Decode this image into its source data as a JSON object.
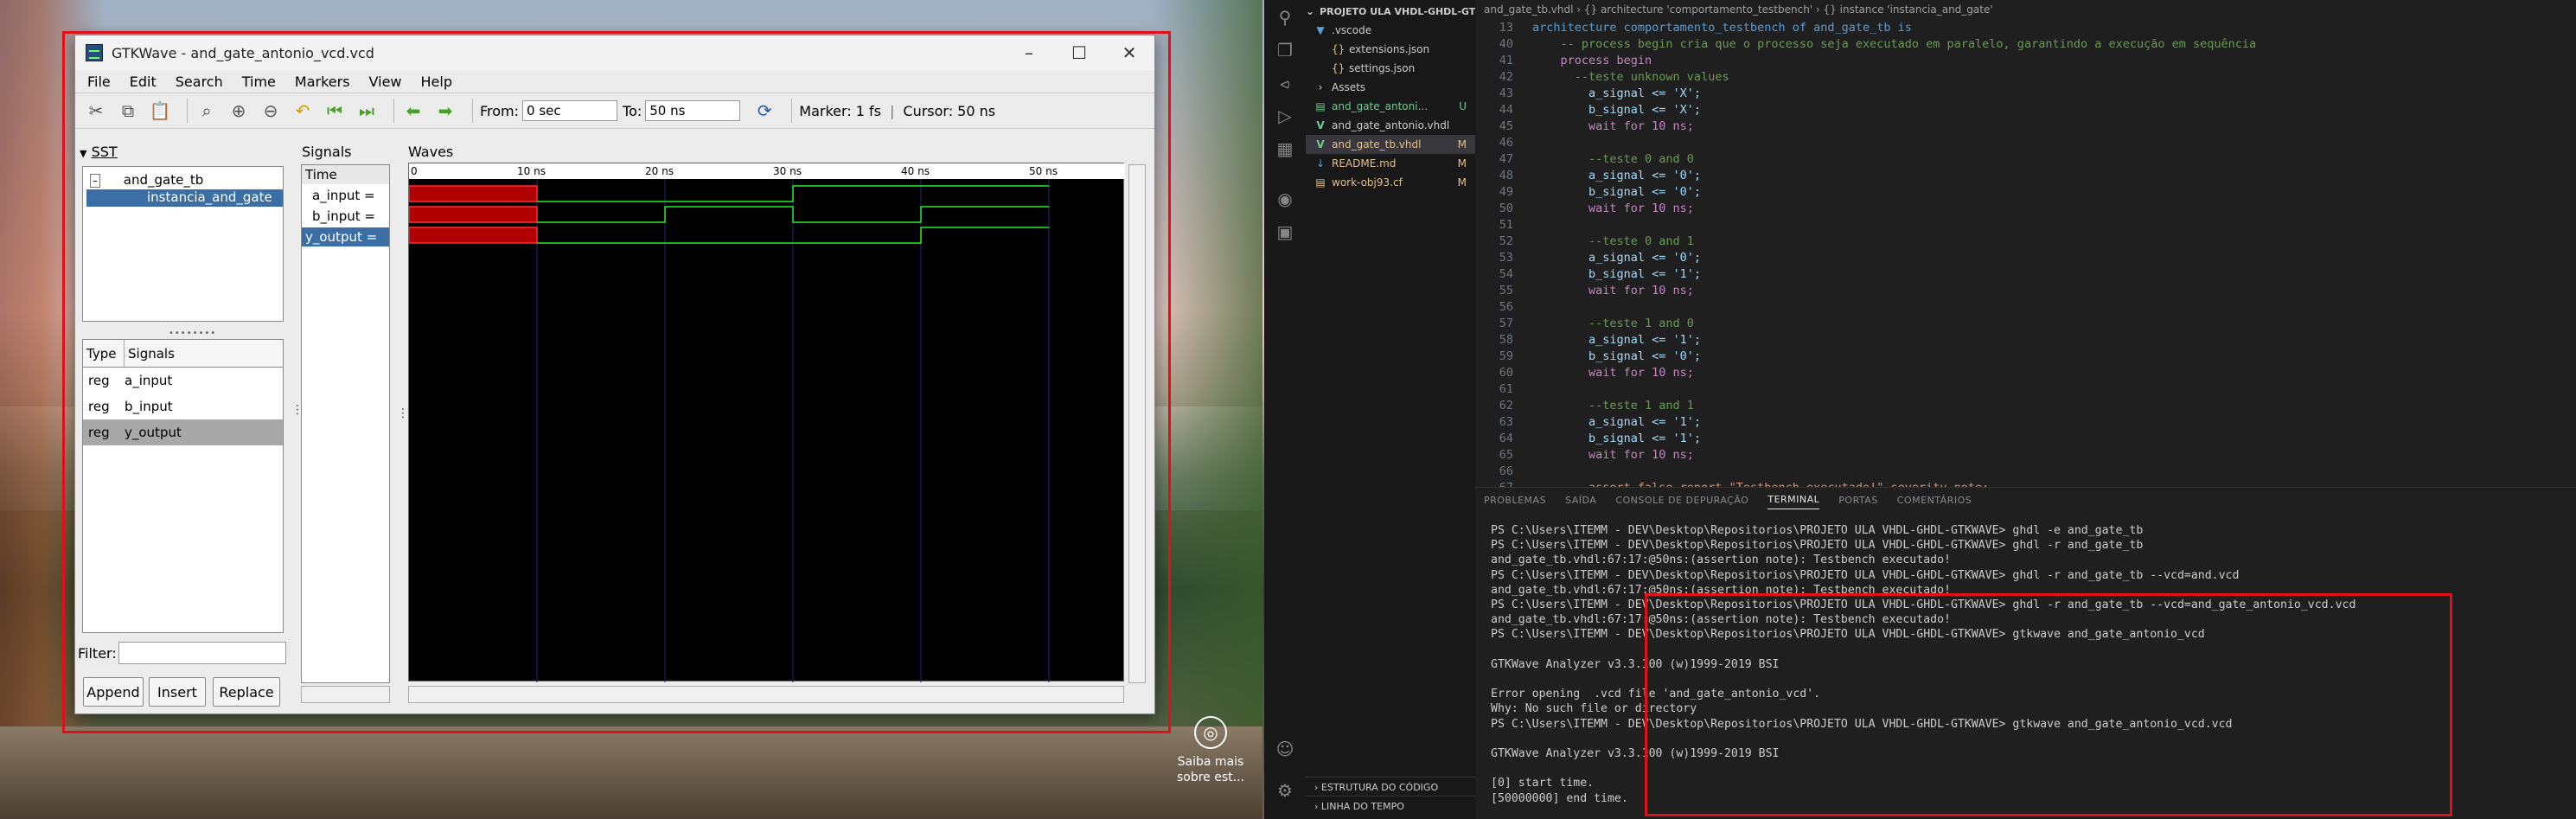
{
  "desktop": {
    "widget_label_1": "Saiba mais",
    "widget_label_2": "sobre est..."
  },
  "gtkwave": {
    "title": "GTKWave - and_gate_antonio_vcd.vcd",
    "menu": [
      "File",
      "Edit",
      "Search",
      "Time",
      "Markers",
      "View",
      "Help"
    ],
    "toolbar": {
      "from_label": "From:",
      "from_value": "0 sec",
      "to_label": "To:",
      "to_value": "50 ns",
      "marker": "Marker: 1 fs",
      "cursor": "Cursor: 50 ns",
      "icons": [
        "cut-icon",
        "copy-icon",
        "paste-icon",
        "zoom-fit-icon",
        "zoom-in-icon",
        "zoom-out-icon",
        "undo-icon",
        "zoom-start-icon",
        "zoom-end-icon",
        "prev-edge-icon",
        "next-edge-icon",
        "reload-icon"
      ]
    },
    "sst": {
      "title": "SST",
      "tree": [
        "and_gate_tb",
        "instancia_and_gate"
      ]
    },
    "signal_table": {
      "col_type": "Type",
      "col_signals": "Signals",
      "rows": [
        {
          "type": "reg",
          "name": "a_input",
          "selected": false
        },
        {
          "type": "reg",
          "name": "b_input",
          "selected": false
        },
        {
          "type": "reg",
          "name": "y_output",
          "selected": true
        }
      ]
    },
    "filter_label": "Filter:",
    "buttons": {
      "append": "Append",
      "insert": "Insert",
      "replace": "Replace"
    },
    "signals_pane": {
      "title": "Signals",
      "time_header": "Time",
      "rows": [
        "a_input =",
        "b_input =",
        "y_output ="
      ]
    },
    "waves_pane": {
      "title": "Waves",
      "tick_labels": [
        "0",
        "10 ns",
        "20 ns",
        "30 ns",
        "40 ns",
        "50 ns"
      ]
    }
  },
  "vscode": {
    "explorer": {
      "root": "PROJETO ULA VHDL-GHDL-GTK...",
      "items": [
        {
          "label": ".vscode",
          "badge": "",
          "color": "#cccccc"
        },
        {
          "label": "extensions.json",
          "badge": "",
          "color": "#cccccc"
        },
        {
          "label": "settings.json",
          "badge": "",
          "color": "#cccccc"
        },
        {
          "label": "Assets",
          "badge": "",
          "color": "#cccccc"
        },
        {
          "label": "and_gate_antoni...",
          "badge": "U",
          "color": "#73c991"
        },
        {
          "label": "and_gate_antonio.vhdl",
          "badge": "",
          "color": "#cccccc"
        },
        {
          "label": "and_gate_tb.vhdl",
          "badge": "M",
          "color": "#e2c08d"
        },
        {
          "label": "README.md",
          "badge": "M",
          "color": "#e2c08d"
        },
        {
          "label": "work-obj93.cf",
          "badge": "M",
          "color": "#e2c08d"
        }
      ],
      "bottom_sections": [
        "ESTRUTURA DO CÓDIGO",
        "LINHA DO TEMPO"
      ]
    },
    "breadcrumbs": "and_gate_tb.vhdl  ›  {} architecture 'comportamento_testbench'  ›  {} instance 'instancia_and_gate'",
    "code": [
      {
        "n": "13",
        "t": "architecture comportamento_testbench of and_gate_tb is"
      },
      {
        "n": "40",
        "t": "    -- process begin cria que o processo seja executado em paralelo, garantindo a execução em sequência"
      },
      {
        "n": "41",
        "t": "    process begin"
      },
      {
        "n": "42",
        "t": "      --teste unknown values"
      },
      {
        "n": "43",
        "t": "        a_signal <= 'X';"
      },
      {
        "n": "44",
        "t": "        b_signal <= 'X';"
      },
      {
        "n": "45",
        "t": "        wait for 10 ns;"
      },
      {
        "n": "46",
        "t": ""
      },
      {
        "n": "47",
        "t": "        --teste 0 and 0"
      },
      {
        "n": "48",
        "t": "        a_signal <= '0';"
      },
      {
        "n": "49",
        "t": "        b_signal <= '0';"
      },
      {
        "n": "50",
        "t": "        wait for 10 ns;"
      },
      {
        "n": "51",
        "t": ""
      },
      {
        "n": "52",
        "t": "        --teste 0 and 1"
      },
      {
        "n": "53",
        "t": "        a_signal <= '0';"
      },
      {
        "n": "54",
        "t": "        b_signal <= '1';"
      },
      {
        "n": "55",
        "t": "        wait for 10 ns;"
      },
      {
        "n": "56",
        "t": ""
      },
      {
        "n": "57",
        "t": "        --teste 1 and 0"
      },
      {
        "n": "58",
        "t": "        a_signal <= '1';"
      },
      {
        "n": "59",
        "t": "        b_signal <= '0';"
      },
      {
        "n": "60",
        "t": "        wait for 10 ns;"
      },
      {
        "n": "61",
        "t": ""
      },
      {
        "n": "62",
        "t": "        --teste 1 and 1"
      },
      {
        "n": "63",
        "t": "        a_signal <= '1';"
      },
      {
        "n": "64",
        "t": "        b_signal <= '1';"
      },
      {
        "n": "65",
        "t": "        wait for 10 ns;"
      },
      {
        "n": "66",
        "t": ""
      },
      {
        "n": "67",
        "t": "        assert false report \"Testbench executado!\" severity note;"
      }
    ],
    "panel_tabs": [
      "PROBLEMAS",
      "SAÍDA",
      "CONSOLE DE DEPURAÇÃO",
      "TERMINAL",
      "PORTAS",
      "COMENTÁRIOS"
    ],
    "active_tab": "TERMINAL",
    "terminal": [
      "PS C:\\Users\\ITEMM - DEV\\Desktop\\Repositorios\\PROJETO ULA VHDL-GHDL-GTKWAVE> ghdl -e and_gate_tb",
      "PS C:\\Users\\ITEMM - DEV\\Desktop\\Repositorios\\PROJETO ULA VHDL-GHDL-GTKWAVE> ghdl -r and_gate_tb",
      "and_gate_tb.vhdl:67:17:@50ns:(assertion note): Testbench executado!",
      "PS C:\\Users\\ITEMM - DEV\\Desktop\\Repositorios\\PROJETO ULA VHDL-GHDL-GTKWAVE> ghdl -r and_gate_tb --vcd=and.vcd",
      "and_gate_tb.vhdl:67:17:@50ns:(assertion note): Testbench executado!",
      "PS C:\\Users\\ITEMM - DEV\\Desktop\\Repositorios\\PROJETO ULA VHDL-GHDL-GTKWAVE> ghdl -r and_gate_tb --vcd=and_gate_antonio_vcd.vcd",
      "and_gate_tb.vhdl:67:17:@50ns:(assertion note): Testbench executado!",
      "PS C:\\Users\\ITEMM - DEV\\Desktop\\Repositorios\\PROJETO ULA VHDL-GHDL-GTKWAVE> gtkwave and_gate_antonio_vcd",
      "",
      "GTKWave Analyzer v3.3.100 (w)1999-2019 BSI",
      "",
      "Error opening  .vcd file 'and_gate_antonio_vcd'.",
      "Why: No such file or directory",
      "PS C:\\Users\\ITEMM - DEV\\Desktop\\Repositorios\\PROJETO ULA VHDL-GHDL-GTKWAVE> gtkwave and_gate_antonio_vcd.vcd",
      "",
      "GTKWave Analyzer v3.3.100 (w)1999-2019 BSI",
      "",
      "[0] start time.",
      "[50000000] end time."
    ]
  }
}
